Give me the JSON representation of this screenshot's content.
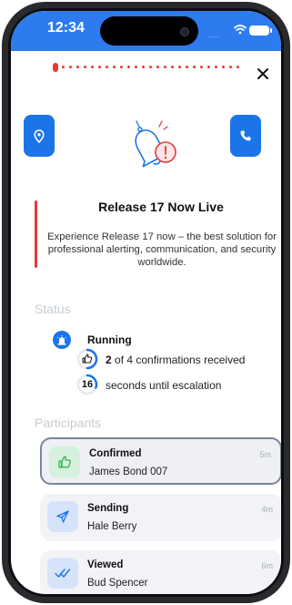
{
  "status_bar": {
    "time": "12:34",
    "signal": "...."
  },
  "header": {
    "close_label": "✕"
  },
  "alert": {
    "title": "Release 17 Now Live",
    "description": "Experience Release 17 now – the best solution for professional alerting, communication, and security worldwide."
  },
  "status": {
    "section_label": "Status",
    "state": "Running",
    "confirmations_count": "2",
    "confirmations_text": " of 4 confirmations received",
    "confirmations_fraction": 0.5,
    "escalation_seconds": "16",
    "escalation_text": "seconds until escalation"
  },
  "participants": {
    "section_label": "Participants",
    "items": [
      {
        "status": "Confirmed",
        "name": "James Bond 007",
        "time": "5m",
        "icon": "thumbs-up-icon",
        "accent": "#2db84d"
      },
      {
        "status": "Sending",
        "name": "Hale Berry",
        "time": "4m",
        "icon": "send-icon",
        "accent": "#1b74e8"
      },
      {
        "status": "Viewed",
        "name": "Bud Spencer",
        "time": "6m",
        "icon": "double-check-icon",
        "accent": "#1b74e8"
      }
    ]
  },
  "colors": {
    "brand": "#1b74e8",
    "alert": "#e53935",
    "statusbar": "#2e7bf0",
    "confirmed": "#2db84d"
  }
}
